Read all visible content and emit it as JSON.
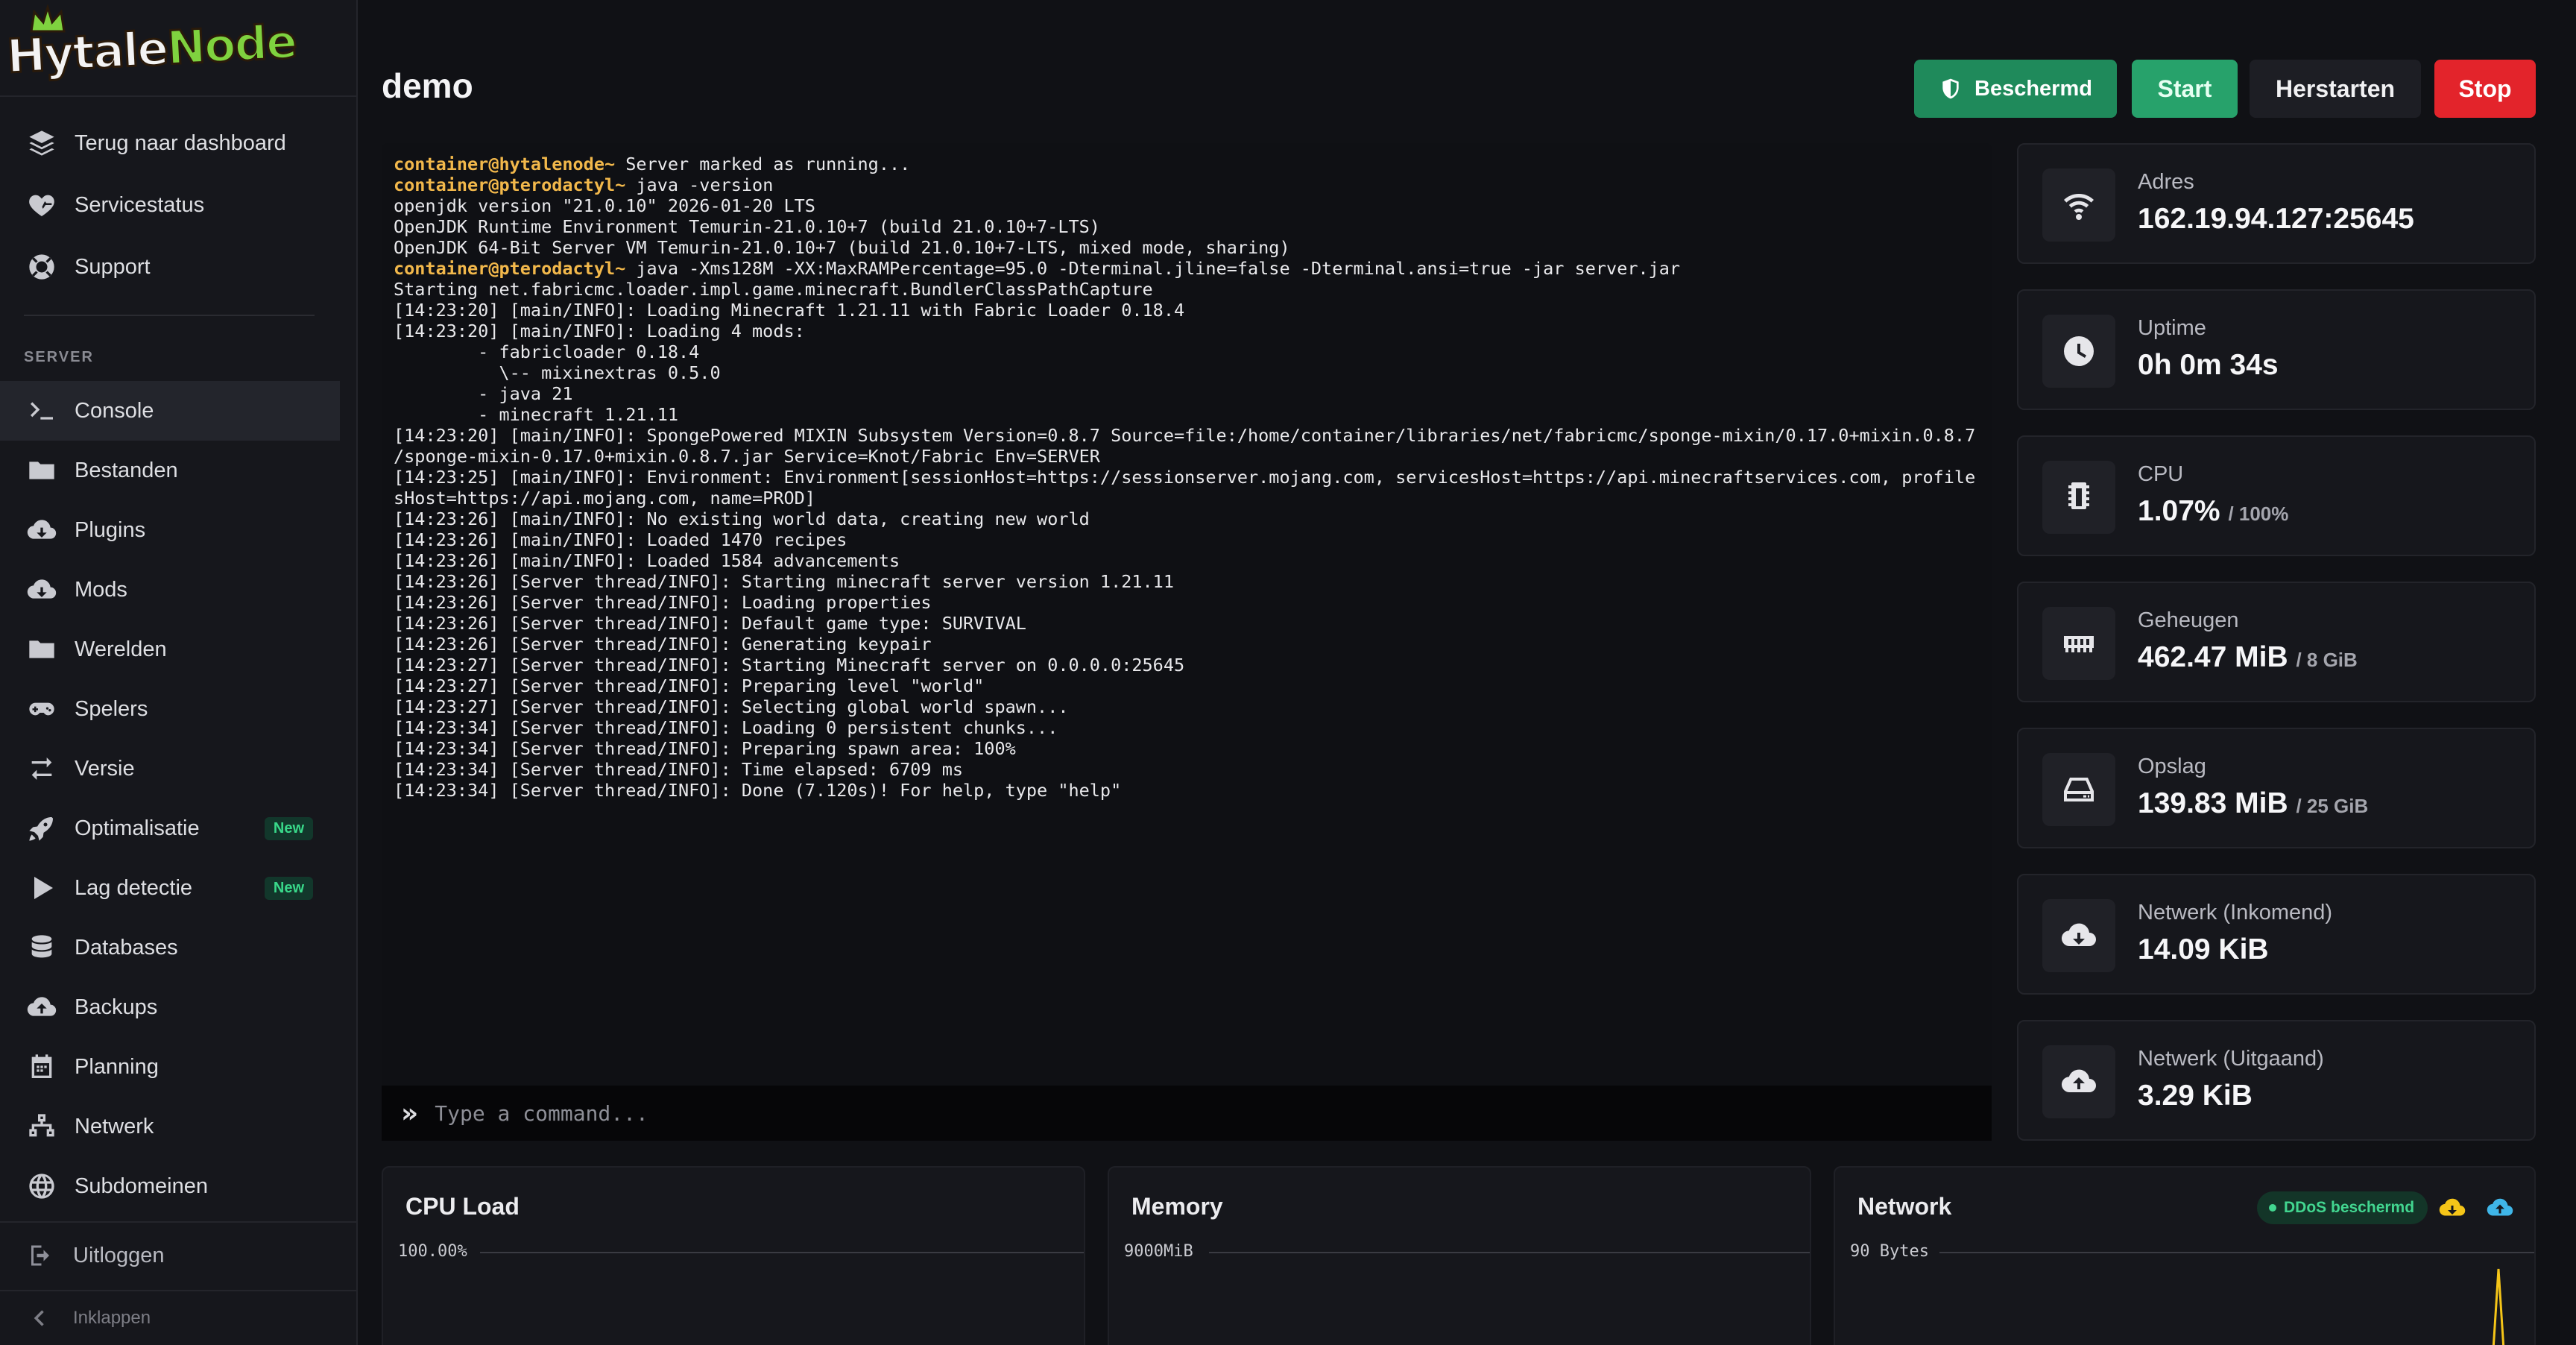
{
  "sidebar": {
    "logo": "HytaleNode",
    "items_top": [
      {
        "label": "Terug naar dashboard",
        "icon": "layers-icon"
      },
      {
        "label": "Servicestatus",
        "icon": "heart-pulse-icon"
      },
      {
        "label": "Support",
        "icon": "lifebuoy-icon"
      }
    ],
    "section_label": "SERVER",
    "items": [
      {
        "label": "Console",
        "icon": "terminal-icon",
        "active": true
      },
      {
        "label": "Bestanden",
        "icon": "folder-icon"
      },
      {
        "label": "Plugins",
        "icon": "cloud-download-icon"
      },
      {
        "label": "Mods",
        "icon": "cloud-download-icon"
      },
      {
        "label": "Werelden",
        "icon": "folder-icon"
      },
      {
        "label": "Spelers",
        "icon": "gamepad-icon"
      },
      {
        "label": "Versie",
        "icon": "swap-icon"
      },
      {
        "label": "Optimalisatie",
        "icon": "rocket-icon",
        "badge": "New"
      },
      {
        "label": "Lag detectie",
        "icon": "play-icon",
        "badge": "New"
      },
      {
        "label": "Databases",
        "icon": "database-icon"
      },
      {
        "label": "Backups",
        "icon": "cloud-upload-icon"
      },
      {
        "label": "Planning",
        "icon": "calendar-icon"
      },
      {
        "label": "Netwerk",
        "icon": "network-icon"
      },
      {
        "label": "Subdomeinen",
        "icon": "globe-icon"
      }
    ],
    "logout_label": "Uitloggen",
    "collapse_label": "Inklappen"
  },
  "header": {
    "title": "demo",
    "protected_label": "Beschermd",
    "start_label": "Start",
    "restart_label": "Herstarten",
    "stop_label": "Stop"
  },
  "console": {
    "lines": [
      {
        "prompt": "container@hytalenode~",
        "text": " Server marked as running..."
      },
      {
        "prompt": "container@pterodactyl~",
        "text": " java -version"
      },
      {
        "prompt": "",
        "text": "openjdk version \"21.0.10\" 2026-01-20 LTS"
      },
      {
        "prompt": "",
        "text": "OpenJDK Runtime Environment Temurin-21.0.10+7 (build 21.0.10+7-LTS)"
      },
      {
        "prompt": "",
        "text": "OpenJDK 64-Bit Server VM Temurin-21.0.10+7 (build 21.0.10+7-LTS, mixed mode, sharing)"
      },
      {
        "prompt": "container@pterodactyl~",
        "text": " java -Xms128M -XX:MaxRAMPercentage=95.0 -Dterminal.jline=false -Dterminal.ansi=true -jar server.jar"
      },
      {
        "prompt": "",
        "text": "Starting net.fabricmc.loader.impl.game.minecraft.BundlerClassPathCapture"
      },
      {
        "prompt": "",
        "text": "[14:23:20] [main/INFO]: Loading Minecraft 1.21.11 with Fabric Loader 0.18.4"
      },
      {
        "prompt": "",
        "text": "[14:23:20] [main/INFO]: Loading 4 mods:"
      },
      {
        "prompt": "",
        "text": "        - fabricloader 0.18.4"
      },
      {
        "prompt": "",
        "text": "          \\-- mixinextras 0.5.0"
      },
      {
        "prompt": "",
        "text": "        - java 21"
      },
      {
        "prompt": "",
        "text": "        - minecraft 1.21.11"
      },
      {
        "prompt": "",
        "text": "[14:23:20] [main/INFO]: SpongePowered MIXIN Subsystem Version=0.8.7 Source=file:/home/container/libraries/net/fabricmc/sponge-mixin/0.17.0+mixin.0.8.7"
      },
      {
        "prompt": "",
        "text": "/sponge-mixin-0.17.0+mixin.0.8.7.jar Service=Knot/Fabric Env=SERVER"
      },
      {
        "prompt": "",
        "text": "[14:23:25] [main/INFO]: Environment: Environment[sessionHost=https://sessionserver.mojang.com, servicesHost=https://api.minecraftservices.com, profile"
      },
      {
        "prompt": "",
        "text": "sHost=https://api.mojang.com, name=PROD]"
      },
      {
        "prompt": "",
        "text": "[14:23:26] [main/INFO]: No existing world data, creating new world"
      },
      {
        "prompt": "",
        "text": "[14:23:26] [main/INFO]: Loaded 1470 recipes"
      },
      {
        "prompt": "",
        "text": "[14:23:26] [main/INFO]: Loaded 1584 advancements"
      },
      {
        "prompt": "",
        "text": "[14:23:26] [Server thread/INFO]: Starting minecraft server version 1.21.11"
      },
      {
        "prompt": "",
        "text": "[14:23:26] [Server thread/INFO]: Loading properties"
      },
      {
        "prompt": "",
        "text": "[14:23:26] [Server thread/INFO]: Default game type: SURVIVAL"
      },
      {
        "prompt": "",
        "text": "[14:23:26] [Server thread/INFO]: Generating keypair"
      },
      {
        "prompt": "",
        "text": "[14:23:27] [Server thread/INFO]: Starting Minecraft server on 0.0.0.0:25645"
      },
      {
        "prompt": "",
        "text": "[14:23:27] [Server thread/INFO]: Preparing level \"world\""
      },
      {
        "prompt": "",
        "text": "[14:23:27] [Server thread/INFO]: Selecting global world spawn..."
      },
      {
        "prompt": "",
        "text": "[14:23:34] [Server thread/INFO]: Loading 0 persistent chunks..."
      },
      {
        "prompt": "",
        "text": "[14:23:34] [Server thread/INFO]: Preparing spawn area: 100%"
      },
      {
        "prompt": "",
        "text": "[14:23:34] [Server thread/INFO]: Time elapsed: 6709 ms"
      },
      {
        "prompt": "",
        "text": "[14:23:34] [Server thread/INFO]: Done (7.120s)! For help, type \"help\""
      }
    ],
    "input_placeholder": "Type a command..."
  },
  "stats": [
    {
      "label": "Adres",
      "value": "162.19.94.127:25645",
      "limit": "",
      "icon": "wifi-icon"
    },
    {
      "label": "Uptime",
      "value": "0h 0m 34s",
      "limit": "",
      "icon": "clock-icon"
    },
    {
      "label": "CPU",
      "value": "1.07%",
      "limit": "/ 100%",
      "icon": "cpu-icon"
    },
    {
      "label": "Geheugen",
      "value": "462.47 MiB",
      "limit": "/ 8 GiB",
      "icon": "memory-icon"
    },
    {
      "label": "Opslag",
      "value": "139.83 MiB",
      "limit": "/ 25 GiB",
      "icon": "hdd-icon"
    },
    {
      "label": "Netwerk (Inkomend)",
      "value": "14.09 KiB",
      "limit": "",
      "icon": "cloud-download-icon"
    },
    {
      "label": "Netwerk (Uitgaand)",
      "value": "3.29 KiB",
      "limit": "",
      "icon": "cloud-upload-icon"
    }
  ],
  "graphs": {
    "cpu": {
      "title": "CPU Load",
      "ymax": "100.00%"
    },
    "memory": {
      "title": "Memory",
      "ymax": "9000MiB"
    },
    "network": {
      "title": "Network",
      "ymax": "90 Bytes",
      "ddos_label": "DDoS beschermd"
    }
  },
  "colors": {
    "accent_green": "#27a26b",
    "protected_green": "#1f8a5b",
    "stop_red": "#e3242b",
    "prompt_yellow": "#f2b84b",
    "badge_green": "#39d98a",
    "network_in": "#f5c518",
    "network_out": "#3fb6e8"
  }
}
